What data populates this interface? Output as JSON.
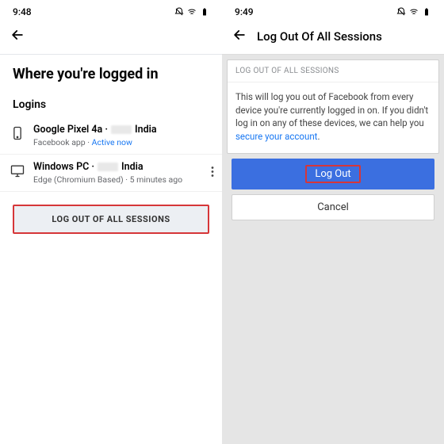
{
  "left": {
    "time": "9:48",
    "header": "Where you're logged in",
    "logins_label": "Logins",
    "rows": [
      {
        "title_prefix": "Google Pixel 4a · ",
        "title_suffix": " India",
        "sub_prefix": "Facebook app · ",
        "sub_active": "Active now"
      },
      {
        "title_prefix": "Windows PC · ",
        "title_suffix": " India",
        "sub": "Edge (Chromium Based) · 5 minutes ago"
      }
    ],
    "logout_all": "LOG OUT OF ALL SESSIONS"
  },
  "right": {
    "time": "9:49",
    "topbar_title": "Log Out Of All Sessions",
    "dialog_header": "LOG OUT OF ALL SESSIONS",
    "dialog_body_1": "This will log you out of Facebook from every device you're currently logged in on. If you didn't log in on any of these devices, we can help you ",
    "dialog_body_link": "secure your account",
    "dialog_body_2": ".",
    "primary": "Log Out",
    "secondary": "Cancel"
  }
}
